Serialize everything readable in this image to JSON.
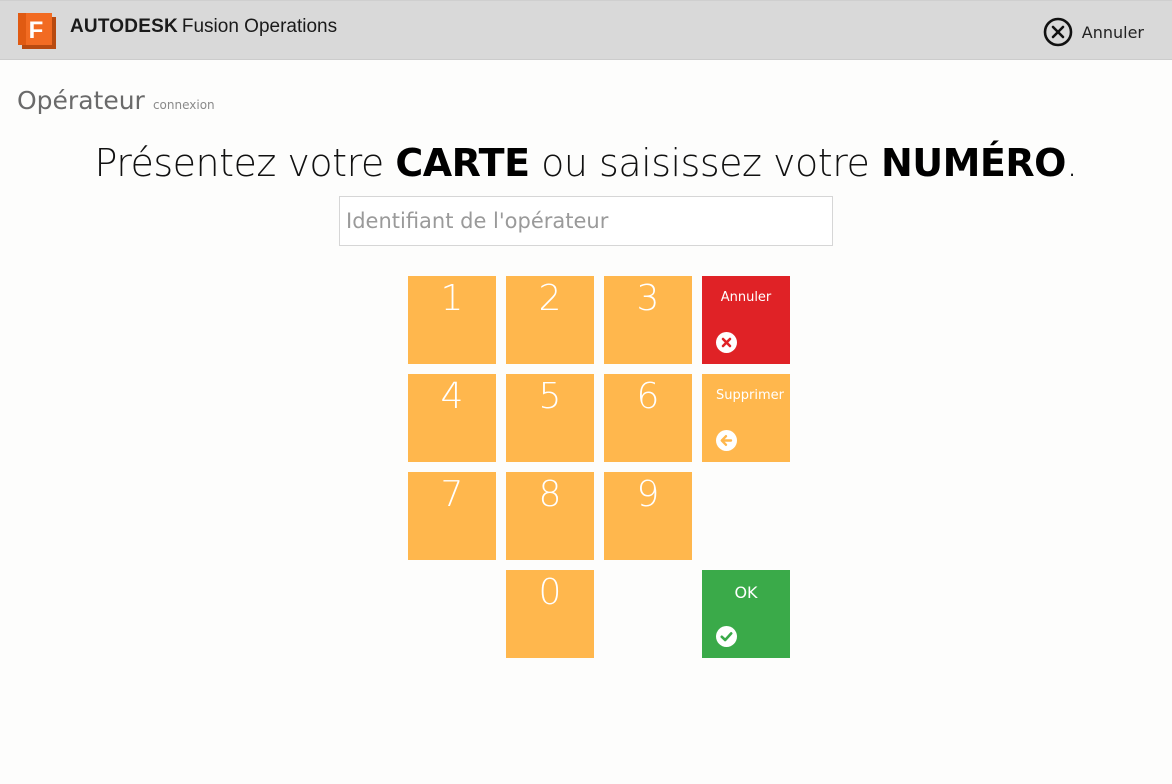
{
  "header": {
    "logo_letter": "F",
    "brand_bold": "AUTODESK",
    "brand_product": "Fusion Operations",
    "cancel_label": "Annuler",
    "cancel_icon": "close-circle-icon"
  },
  "page": {
    "title": "Opérateur",
    "subtitle": "connexion"
  },
  "instruction": {
    "part1": "Présentez votre ",
    "bold1": "CARTE",
    "part2": " ou saisissez votre ",
    "bold2": "NUMÉRO",
    "part3": "."
  },
  "input": {
    "placeholder": "Identifiant de l'opérateur",
    "value": ""
  },
  "keypad": {
    "keys": [
      "1",
      "2",
      "3",
      "4",
      "5",
      "6",
      "7",
      "8",
      "9",
      "0"
    ],
    "cancel_label": "Annuler",
    "delete_label": "Supprimer",
    "ok_label": "OK"
  },
  "colors": {
    "key": "#ffb74d",
    "cancel": "#e02226",
    "ok": "#3aaa49",
    "header": "#d9d9d9"
  }
}
